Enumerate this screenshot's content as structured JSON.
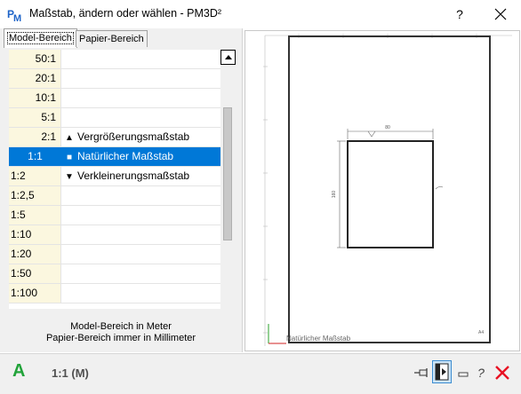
{
  "window": {
    "title": "Maßstab, ändern oder wählen - PM3D²",
    "help_label": "?"
  },
  "tabs": [
    {
      "label": "Model-Bereich",
      "active": true
    },
    {
      "label": "Papier-Bereich",
      "active": false
    }
  ],
  "scale_list": [
    {
      "scale": "50:1",
      "desc": "",
      "symbol": "",
      "align": "right",
      "selected": false
    },
    {
      "scale": "20:1",
      "desc": "",
      "symbol": "",
      "align": "right",
      "selected": false
    },
    {
      "scale": "10:1",
      "desc": "",
      "symbol": "",
      "align": "right",
      "selected": false
    },
    {
      "scale": "5:1",
      "desc": "",
      "symbol": "",
      "align": "right",
      "selected": false
    },
    {
      "scale": "2:1",
      "desc": "Vergrößerungsmaßstab",
      "symbol": "▲",
      "align": "right",
      "selected": false
    },
    {
      "scale": "1:1",
      "desc": "Natürlicher Maßstab",
      "symbol": "■",
      "align": "center",
      "selected": true
    },
    {
      "scale": "1:2",
      "desc": "Verkleinerungsmaßstab",
      "symbol": "▼",
      "align": "left",
      "selected": false
    },
    {
      "scale": "1:2,5",
      "desc": "",
      "symbol": "",
      "align": "left",
      "selected": false
    },
    {
      "scale": "1:5",
      "desc": "",
      "symbol": "",
      "align": "left",
      "selected": false
    },
    {
      "scale": "1:10",
      "desc": "",
      "symbol": "",
      "align": "left",
      "selected": false
    },
    {
      "scale": "1:20",
      "desc": "",
      "symbol": "",
      "align": "left",
      "selected": false
    },
    {
      "scale": "1:50",
      "desc": "",
      "symbol": "",
      "align": "left",
      "selected": false
    },
    {
      "scale": "1:100",
      "desc": "",
      "symbol": "",
      "align": "left",
      "selected": false
    }
  ],
  "info": {
    "line1": "Model-Bereich in Meter",
    "line2": "Papier-Bereich immer in Millimeter"
  },
  "preview": {
    "dimension_width": "80",
    "dimension_height": "160",
    "footer_label": "Natürlicher Maßstab",
    "sheet_format": "A4"
  },
  "status": {
    "mode_letter": "A",
    "current_scale": "1:1 (M)"
  },
  "colors": {
    "selection": "#0078d7",
    "scale_column": "#fbf7df",
    "mode_letter": "#22a33a",
    "close_icon": "#e81123"
  },
  "icons": [
    "app-logo-icon",
    "close-icon",
    "scroll-up-arrow-icon",
    "pin-icon",
    "dock-panel-icon",
    "minimize-icon",
    "help-icon",
    "cancel-icon"
  ]
}
